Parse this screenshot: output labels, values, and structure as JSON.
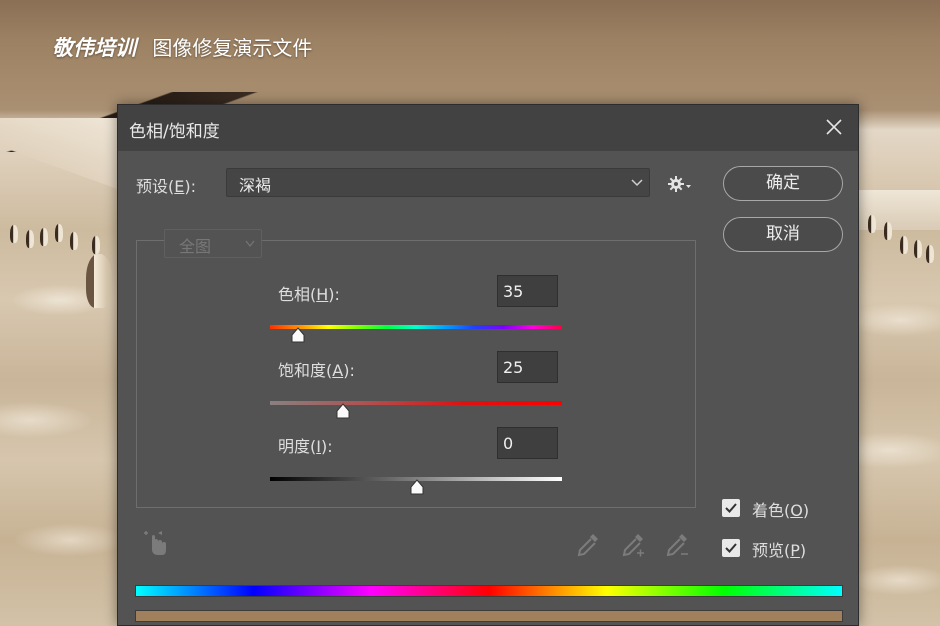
{
  "banner": {
    "brand": "敬伟培训",
    "subtitle": "图像修复演示文件"
  },
  "dialog": {
    "title": "色相/饱和度",
    "close_icon": "close-icon",
    "preset": {
      "label_prefix": "预设(",
      "label_key": "E",
      "label_suffix": "):",
      "value": "深褐"
    },
    "gear_icon": "gear-icon",
    "buttons": {
      "ok": "确定",
      "cancel": "取消"
    },
    "channel": {
      "value": "全图"
    },
    "sliders": {
      "hue": {
        "label_prefix": "色相(",
        "label_key": "H",
        "label_suffix": "):",
        "value": "35"
      },
      "saturation": {
        "label_prefix": "饱和度(",
        "label_key": "A",
        "label_suffix": "):",
        "value": "25"
      },
      "lightness": {
        "label_prefix": "明度(",
        "label_key": "I",
        "label_suffix": "):",
        "value": "0"
      }
    },
    "colorize": {
      "label_prefix": "着色(",
      "label_key": "O",
      "label_suffix": ")",
      "checked": true
    },
    "preview": {
      "label_prefix": "预览(",
      "label_key": "P",
      "label_suffix": ")",
      "checked": true
    },
    "tools": [
      "targeted-adjustment-icon",
      "eyedropper-icon",
      "eyedropper-add-icon",
      "eyedropper-subtract-icon"
    ],
    "colors": {
      "dialog_bg": "#535353",
      "titlebar_bg": "#424242",
      "sepia_ramp": "#a1805d"
    }
  }
}
